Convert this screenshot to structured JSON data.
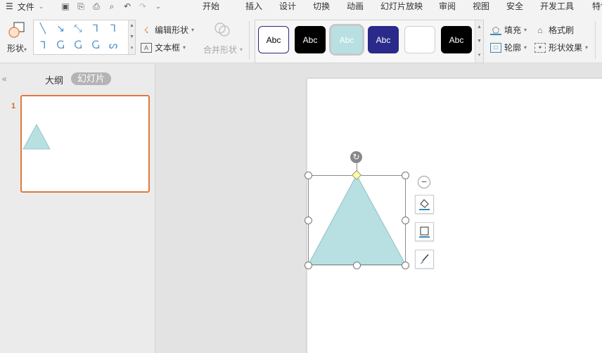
{
  "menubar": {
    "file_label": "文件",
    "tabs": [
      "开始",
      "插入",
      "设计",
      "切换",
      "动画",
      "幻灯片放映",
      "审阅",
      "视图",
      "安全",
      "开发工具",
      "特色"
    ]
  },
  "ribbon": {
    "shape_label": "形状",
    "edit_shape_label": "编辑形状",
    "textbox_label": "文本框",
    "merge_shape_label": "合并形状",
    "style_presets": [
      {
        "label": "Abc",
        "bg": "#ffffff",
        "fg": "#000000",
        "border": "#2a2a7a"
      },
      {
        "label": "Abc",
        "bg": "#000000",
        "fg": "#ffffff",
        "border": "#000000"
      },
      {
        "label": "Abc",
        "bg": "#b8e0e2",
        "fg": "#ffffff",
        "border": "#b8e0e2"
      },
      {
        "label": "Abc",
        "bg": "#2a2a8a",
        "fg": "#ffffff",
        "border": "#2a2a8a"
      },
      {
        "label": "",
        "bg": "#ffffff",
        "fg": "#000000",
        "border": "#cfcfcf"
      },
      {
        "label": "Abc",
        "bg": "#000000",
        "fg": "#ffffff",
        "border": "#000000"
      }
    ],
    "fill_label": "填充",
    "format_painter_label": "格式刷",
    "outline_label": "轮廓",
    "shape_effect_label": "形状效果"
  },
  "left_panel": {
    "tab_outline": "大纲",
    "tab_slides": "幻灯片",
    "slide_number": "1"
  },
  "colors": {
    "triangle_fill": "#b8e0e2",
    "triangle_stroke": "#8fbfc2",
    "thumb_border": "#e07a3a"
  }
}
